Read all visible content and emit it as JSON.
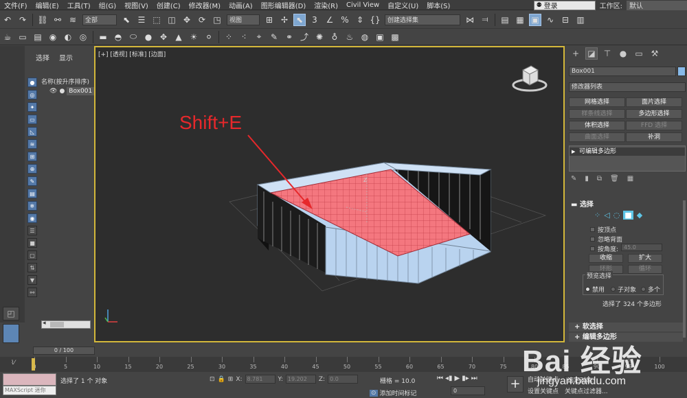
{
  "menu": {
    "items": [
      "文件(F)",
      "编辑(E)",
      "工具(T)",
      "组(G)",
      "视图(V)",
      "创建(C)",
      "修改器(M)",
      "动画(A)",
      "图形编辑器(D)",
      "渲染(R)",
      "Civil View",
      "自定义(U)",
      "脚本(S)"
    ],
    "login": "登录",
    "workspace_label": "工作区:",
    "workspace_value": "默认"
  },
  "toolbar": {
    "filter_select": "全部",
    "coord_select": "视图",
    "named_sel": "创建选择集"
  },
  "explorer": {
    "tab_select": "选择",
    "tab_display": "显示",
    "header": "名称(按升序排序)",
    "object": "Box001"
  },
  "viewport": {
    "label": "[+] [透视] [标准] [边面]",
    "annotation": "Shift+E",
    "annotation_color": "#e6282b",
    "selection_color": "#f4777f",
    "wall_color": "#b9d3ef",
    "frame_color": "#d4b83a"
  },
  "command_panel": {
    "object_name": "Box001",
    "modifier_list": "修改器列表",
    "buttons": [
      {
        "label": "网格选择",
        "enabled": true
      },
      {
        "label": "面片选择",
        "enabled": true
      },
      {
        "label": "样条线选择",
        "enabled": false
      },
      {
        "label": "多边形选择",
        "enabled": true
      },
      {
        "label": "体积选择",
        "enabled": true
      },
      {
        "label": "FFD 选择",
        "enabled": false
      },
      {
        "label": "曲面选择",
        "enabled": false
      },
      {
        "label": "补洞",
        "enabled": true
      }
    ],
    "stack_item": "可编辑多边形",
    "rollout_selection": "选择",
    "check_by_vertex": "按顶点",
    "check_ignore_backface": "忽略背面",
    "check_by_angle": "按角度:",
    "angle_value": "45.0",
    "btn_shrink": "收缩",
    "btn_grow": "扩大",
    "btn_ring": "环形",
    "btn_loop": "循环",
    "preview_label": "预览选择",
    "radio_disable": "禁用",
    "radio_subobj": "子对象",
    "radio_multi": "多个",
    "status": "选择了 324 个多边形",
    "rollout_soft": "软选择",
    "rollout_edit": "编辑多边形"
  },
  "bottom": {
    "time_slider": "0 / 100",
    "ticks": [
      "0",
      "5",
      "10",
      "15",
      "20",
      "25",
      "30",
      "35",
      "40",
      "45",
      "50",
      "55",
      "60",
      "65",
      "70",
      "75",
      "80",
      "85",
      "90",
      "95",
      "100"
    ],
    "maxscript_placeholder": "MAXScript 迷你",
    "status_selected": "选择了 1 个 对象",
    "x_value": "8.781",
    "y_value": "19.202",
    "z_value": "0.0",
    "grid": "栅格 = 10.0",
    "add_time_tag": "添加时间标记",
    "frame_value": "0",
    "auto_key": "自动关键点",
    "selected_obj": "选定对象",
    "set_key": "设置关键点",
    "key_filter": "关键点过滤器..."
  },
  "watermark": {
    "logo": "Bai 经验",
    "url": "jingyan.baidu.com"
  }
}
